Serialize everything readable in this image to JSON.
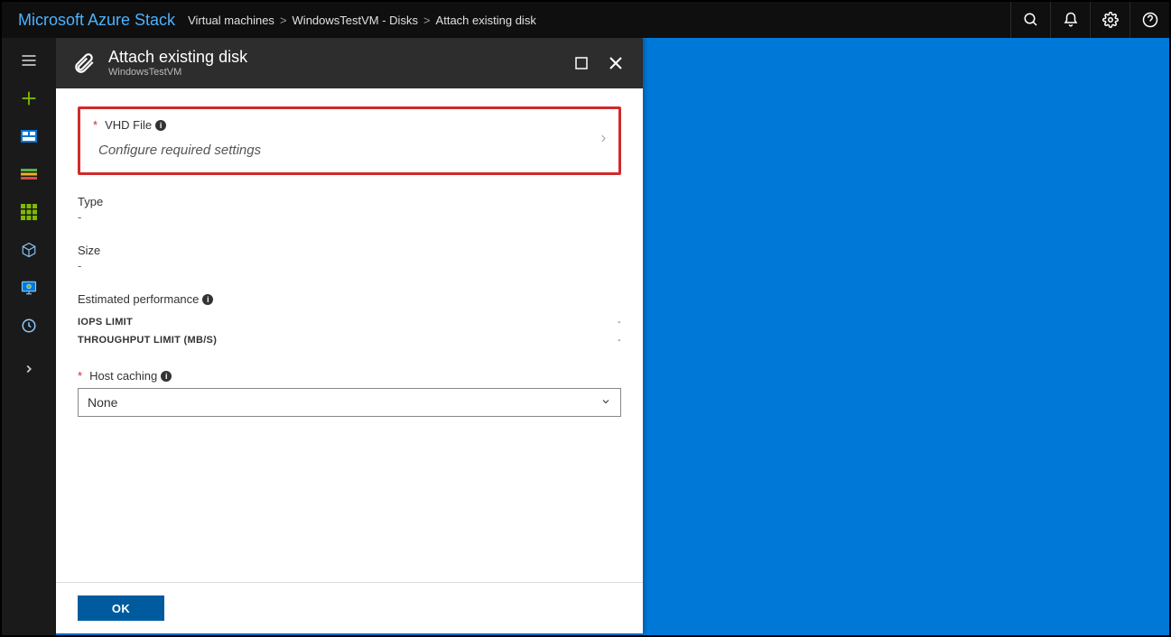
{
  "brand": "Microsoft Azure Stack",
  "breadcrumbs": {
    "items": [
      {
        "label": "Virtual machines"
      },
      {
        "label": "WindowsTestVM - Disks"
      },
      {
        "label": "Attach existing disk"
      }
    ],
    "separator": ">"
  },
  "blade": {
    "title": "Attach existing disk",
    "subtitle": "WindowsTestVM"
  },
  "fields": {
    "vhd": {
      "label": "VHD File",
      "placeholder": "Configure required settings"
    },
    "type": {
      "label": "Type",
      "value": "-"
    },
    "size": {
      "label": "Size",
      "value": "-"
    },
    "perf": {
      "label": "Estimated performance",
      "rows": [
        {
          "label": "IOPS LIMIT",
          "value": "-"
        },
        {
          "label": "THROUGHPUT LIMIT (MB/S)",
          "value": "-"
        }
      ]
    },
    "hostCaching": {
      "label": "Host caching",
      "value": "None"
    }
  },
  "buttons": {
    "ok": "OK"
  }
}
